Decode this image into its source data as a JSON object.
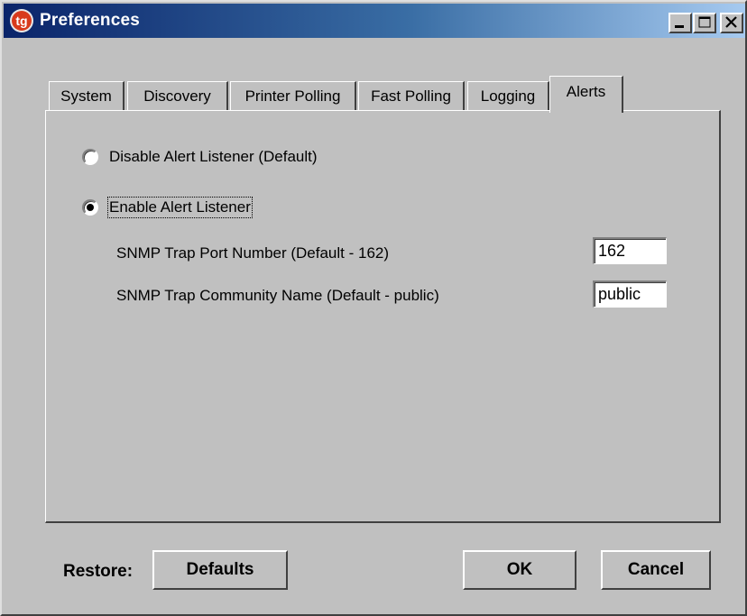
{
  "window": {
    "title": "Preferences",
    "icon": "tg-app-icon"
  },
  "tabs": [
    {
      "label": "System",
      "active": false
    },
    {
      "label": "Discovery",
      "active": false
    },
    {
      "label": "Printer Polling",
      "active": false
    },
    {
      "label": "Fast Polling",
      "active": false
    },
    {
      "label": "Logging",
      "active": false
    },
    {
      "label": "Alerts",
      "active": true
    }
  ],
  "alerts": {
    "disable_label": "Disable Alert Listener (Default)",
    "disable_selected": false,
    "enable_label": "Enable Alert Listener",
    "enable_selected": true,
    "port_label": "SNMP Trap Port Number (Default - 162)",
    "port_value": "162",
    "community_label": "SNMP Trap Community Name (Default - public)",
    "community_value": "public"
  },
  "footer": {
    "restore_label": "Restore:",
    "defaults_label": "Defaults",
    "ok_label": "OK",
    "cancel_label": "Cancel"
  },
  "colors": {
    "titlebar_start": "#0a246a",
    "titlebar_end": "#a6caf0",
    "face": "#c0c0c0"
  }
}
